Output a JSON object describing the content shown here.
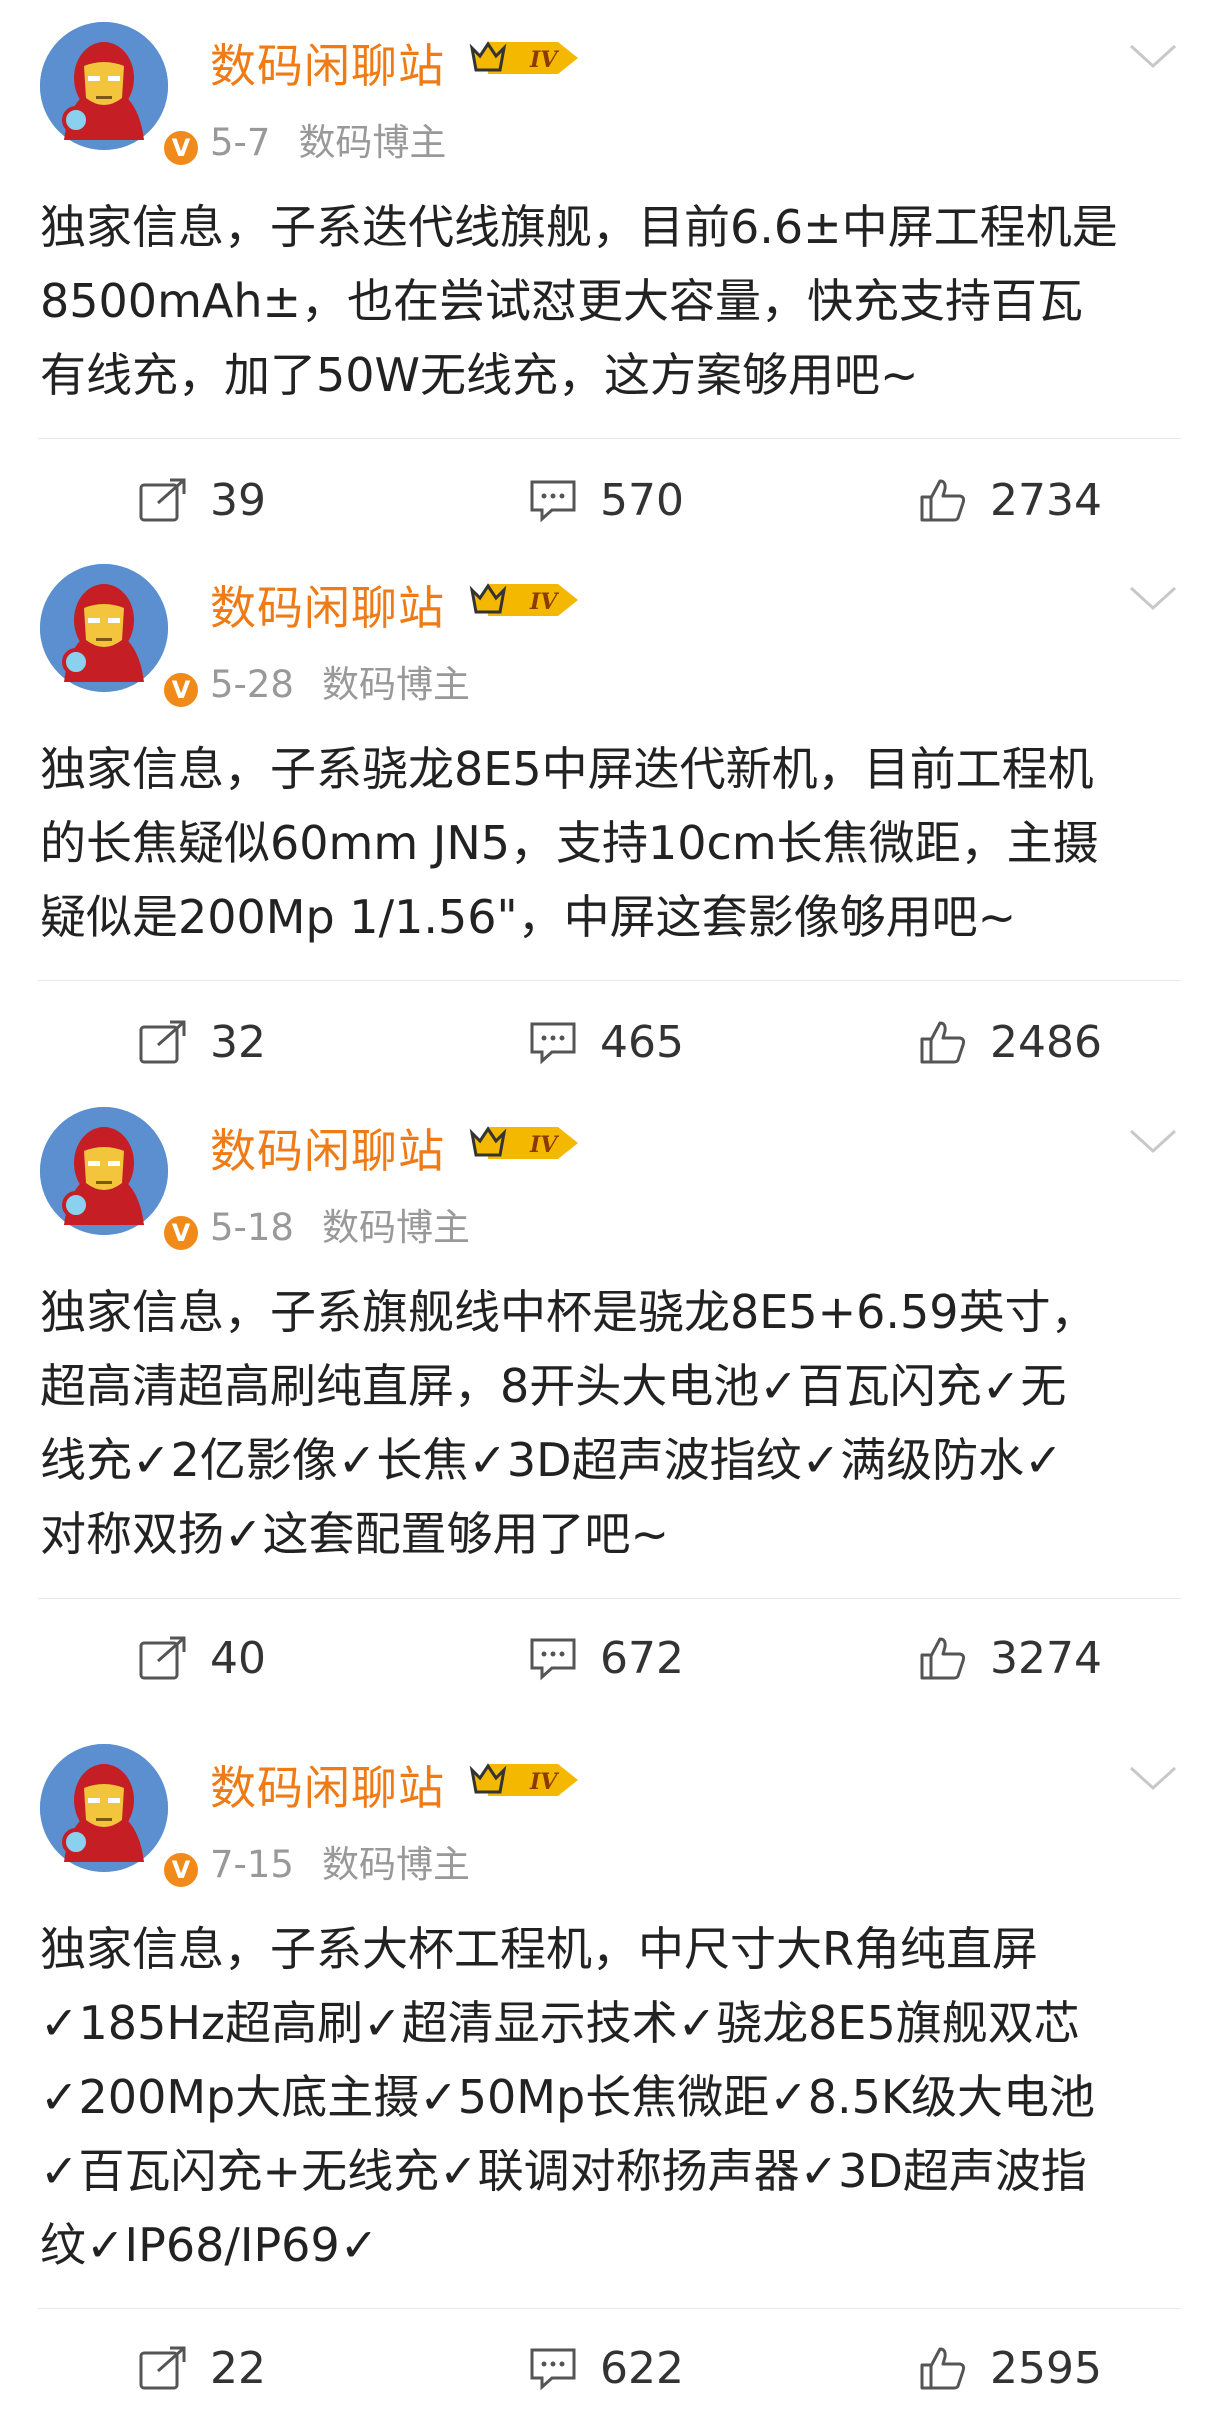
{
  "posts": [
    {
      "author": "数码闲聊站",
      "level": "IV",
      "date": "5-7",
      "role": "数码博主",
      "content": "独家信息，子系迭代线旗舰，目前6.6±中屏工程机是\n8500mAh±，也在尝试怼更大容量，快充支持百瓦\n有线充，加了50W无线充，这方案够用吧~",
      "reposts": "39",
      "comments": "570",
      "likes": "2734"
    },
    {
      "author": "数码闲聊站",
      "level": "IV",
      "date": "5-28",
      "role": "数码博主",
      "content": "独家信息，子系骁龙8E5中屏迭代新机，目前工程机\n的长焦疑似60mm JN5，支持10cm长焦微距，主摄\n疑似是200Mp 1/1.56\"，中屏这套影像够用吧~",
      "reposts": "32",
      "comments": "465",
      "likes": "2486"
    },
    {
      "author": "数码闲聊站",
      "level": "IV",
      "date": "5-18",
      "role": "数码博主",
      "content": "独家信息，子系旗舰线中杯是骁龙8E5+6.59英寸，\n超高清超高刷纯直屏，8开头大电池✓百瓦闪充✓无\n线充✓2亿影像✓长焦✓3D超声波指纹✓满级防水✓\n对称双扬✓这套配置够用了吧~",
      "reposts": "40",
      "comments": "672",
      "likes": "3274"
    },
    {
      "author": "数码闲聊站",
      "level": "IV",
      "date": "7-15",
      "role": "数码博主",
      "content": "独家信息，子系大杯工程机，中尺寸大R角纯直屏\n✓185Hz超高刷✓超清显示技术✓骁龙8E5旗舰双芯\n✓200Mp大底主摄✓50Mp长焦微距✓8.5K级大电池\n✓百瓦闪充+无线充✓联调对称扬声器✓3D超声波指\n纹✓IP68/IP69✓",
      "reposts": "22",
      "comments": "622",
      "likes": "2595"
    }
  ],
  "icons": {
    "avatar": "iron-man-avatar",
    "verified": "verified-v-icon",
    "level": "crown-level-badge",
    "menu": "chevron-down-icon",
    "repost": "repost-icon",
    "comment": "comment-icon",
    "like": "thumbs-up-icon"
  },
  "colors": {
    "name": "#ee7b16",
    "meta": "#999999",
    "verified": "#f08a1a",
    "level": "#f5b800"
  },
  "verified_mark": "V"
}
